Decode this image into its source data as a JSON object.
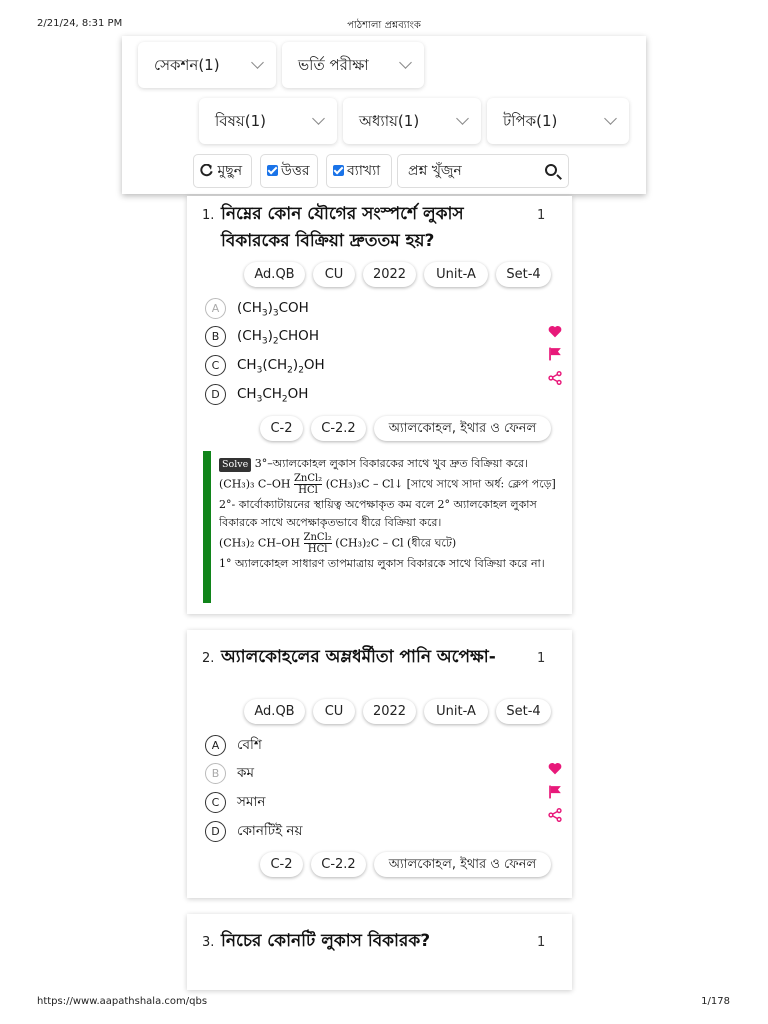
{
  "print": {
    "datetime": "2/21/24, 8:31 PM",
    "title": "পাঠশালা প্রশ্নব্যাংক",
    "url": "https://www.aapathshala.com/qbs",
    "page": "1/178"
  },
  "filters": {
    "row1": [
      {
        "label": "সেকশন(1)"
      },
      {
        "label": "ভর্তি পরীক্ষা"
      }
    ],
    "row2": [
      {
        "label": "বিষয়(1)"
      },
      {
        "label": "অধ্যায়(1)"
      },
      {
        "label": "টপিক(1)"
      }
    ],
    "tools": {
      "clear_label": "মুছুন",
      "answer_label": "উত্তর",
      "answer_checked": true,
      "explain_label": "ব্যাখ্যা",
      "explain_checked": true,
      "search_placeholder": "প্রশ্ন খুঁজুন"
    }
  },
  "questions": [
    {
      "number": "1.",
      "text": "নিম্নের কোন যৌগের সংস্পর্শে লুকাস বিকারকের বিক্রিয়া দ্রুততম হয়?",
      "marks": "1",
      "tags": [
        "Ad.QB",
        "CU",
        "2022",
        "Unit-A",
        "Set-4"
      ],
      "options": [
        {
          "letter": "A",
          "text": "(CH3)3COH",
          "faint": true
        },
        {
          "letter": "B",
          "text": "(CH3)2CHOH",
          "faint": false
        },
        {
          "letter": "C",
          "text": "CH3(CH2)2OH",
          "faint": false
        },
        {
          "letter": "D",
          "text": "CH3CH2OH",
          "faint": false
        }
      ],
      "topic_tags": [
        "C-2",
        "C-2.2",
        "অ্যালকোহল, ইথার ও ফেনল"
      ],
      "solution": {
        "badge": "Solve",
        "line1": "3°–অ্যালকোহল লুকাস বিকারকের সাথে খুব দ্রুত বিক্রিয়া করে।",
        "eq1_left": "(CH₃)₃ C–OH",
        "eq1_cat_top": "ZnCl₂",
        "eq1_cat_bottom": "HCl",
        "eq1_right": "(CH₃)₃C – Cl↓ [সাথে সাথে সাদা অর্ধ: ক্লেপ পড়ে]",
        "line2": "2°- কার্বোক্যাটায়নের স্থায়িত্ব অপেক্ষাকৃত কম বলে 2° অ্যালকোহল লুকাস",
        "line3": "বিকারকে সাথে অপেক্ষাকৃতভাবে ধীরে বিক্রিয়া করে।",
        "eq2_left": "(CH₃)₂ CH–OH",
        "eq2_cat_top": "ZnCl₂",
        "eq2_cat_bottom": "HCl",
        "eq2_right": "(CH₃)₂C – Cl (ধীরে ঘটে)",
        "line4": "1° অ্যালকোহল সাধারণ তাপমাত্রায় লুকাস বিকারকে সাথে বিক্রিয়া করে না।"
      }
    },
    {
      "number": "2.",
      "text": "অ্যালকোহলের অম্লধর্মীতা পানি অপেক্ষা-",
      "marks": "1",
      "tags": [
        "Ad.QB",
        "CU",
        "2022",
        "Unit-A",
        "Set-4"
      ],
      "options": [
        {
          "letter": "A",
          "text": "বেশি",
          "faint": false
        },
        {
          "letter": "B",
          "text": "কম",
          "faint": true
        },
        {
          "letter": "C",
          "text": "সমান",
          "faint": false
        },
        {
          "letter": "D",
          "text": "কোনটিই নয়",
          "faint": false
        }
      ],
      "topic_tags": [
        "C-2",
        "C-2.2",
        "অ্যালকোহল, ইথার ও ফেনল"
      ]
    },
    {
      "number": "3.",
      "text": "নিচের কোনটি লুকাস বিকারক?",
      "marks": "1"
    }
  ],
  "colors": {
    "accent_pink": "#e8197a",
    "solve_bar": "#10841a",
    "checkbox_blue": "#1a73e8"
  },
  "icons": [
    "refresh-icon",
    "checkbox-icon",
    "search-icon",
    "chevron-down-icon",
    "heart-icon",
    "flag-icon",
    "share-icon"
  ]
}
